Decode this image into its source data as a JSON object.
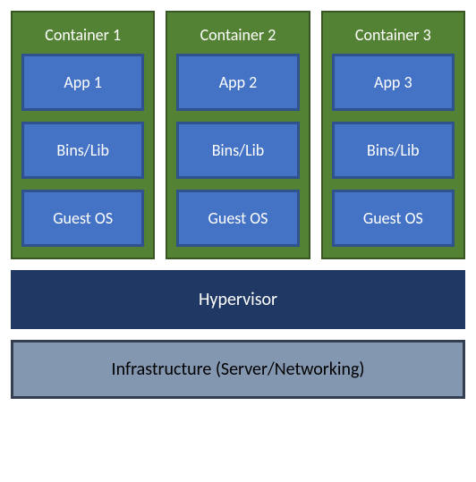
{
  "containers": [
    {
      "title": "Container 1",
      "app": "App 1",
      "binslib": "Bins/Lib",
      "guestos": "Guest OS"
    },
    {
      "title": "Container 2",
      "app": "App 2",
      "binslib": "Bins/Lib",
      "guestos": "Guest OS"
    },
    {
      "title": "Container 3",
      "app": "App 3",
      "binslib": "Bins/Lib",
      "guestos": "Guest OS"
    }
  ],
  "layers": {
    "hypervisor": "Hypervisor",
    "infrastructure": "Infrastructure (Server/Networking)"
  }
}
